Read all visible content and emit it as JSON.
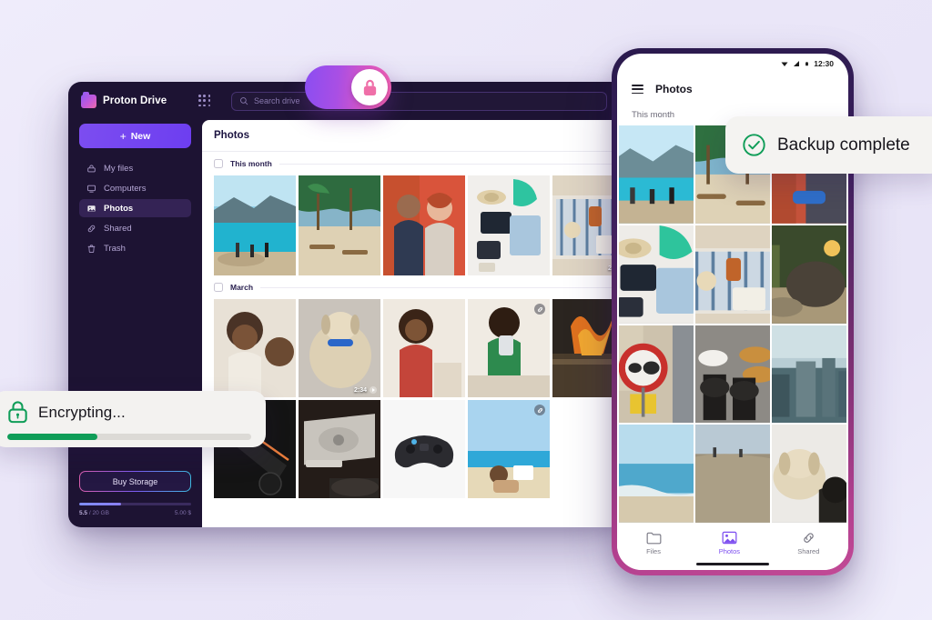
{
  "desktop": {
    "brand_name": "Proton Drive",
    "apps_icon": "apps-grid-icon",
    "search": {
      "placeholder": "Search drive",
      "value": "",
      "icon": "search-icon"
    },
    "new_button_label": "New",
    "nav": [
      {
        "label": "My files",
        "icon": "drive-icon",
        "active": false
      },
      {
        "label": "Computers",
        "icon": "monitor-icon",
        "active": false
      },
      {
        "label": "Photos",
        "icon": "image-icon",
        "active": true
      },
      {
        "label": "Shared",
        "icon": "link-icon",
        "active": false
      },
      {
        "label": "Trash",
        "icon": "trash-icon",
        "active": false
      }
    ],
    "storage": {
      "buy_label": "Buy Storage",
      "used": "5.5",
      "total": "/ 20 GB",
      "right_label": "5.00 $",
      "percent": 37
    },
    "content": {
      "title": "Photos",
      "groups": [
        {
          "label": "This month",
          "checked": false
        },
        {
          "label": "March",
          "checked": false
        }
      ],
      "video_badge_duration": "2:34"
    }
  },
  "phone": {
    "status": {
      "time": "12:30",
      "wifi_icon": "wifi-icon",
      "signal_icon": "signal-icon",
      "battery_icon": "battery-icon"
    },
    "menu_icon": "hamburger-menu-icon",
    "title": "Photos",
    "group_label": "This month",
    "nav": [
      {
        "label": "Files",
        "icon": "folder-icon",
        "active": false
      },
      {
        "label": "Photos",
        "icon": "image-icon",
        "active": true
      },
      {
        "label": "Shared",
        "icon": "link-icon",
        "active": false
      }
    ]
  },
  "toggle": {
    "state": "on",
    "icon": "lock-icon"
  },
  "toasts": {
    "encrypting": {
      "text": "Encrypting...",
      "icon": "lock-icon",
      "percent": 37,
      "color": "#0f9d58"
    },
    "backup": {
      "text": "Backup complete",
      "icon": "check-circle-icon",
      "color": "#0f9d58"
    }
  },
  "colors": {
    "background": "#eae6f8",
    "window_bg": "#1d1333",
    "accent_purple": "#7c4df0",
    "green": "#0f9d58"
  }
}
